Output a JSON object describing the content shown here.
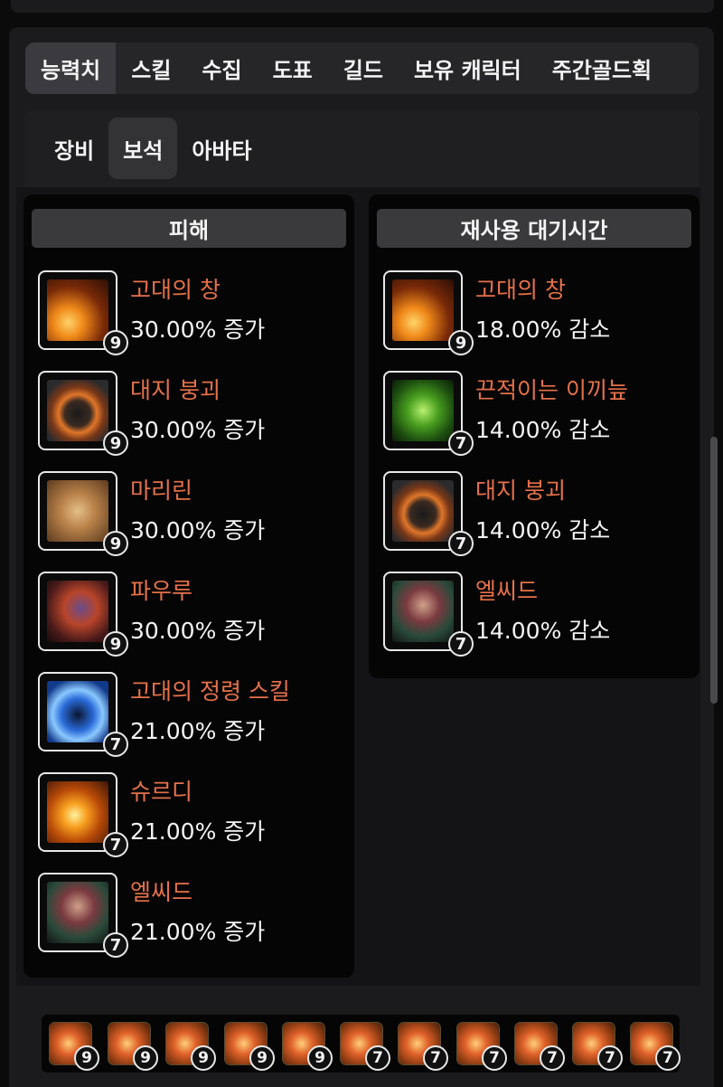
{
  "main_tabs": [
    "능력치",
    "스킬",
    "수집",
    "도표",
    "길드",
    "보유 캐릭터",
    "주간골드획"
  ],
  "sub_tabs": [
    "장비",
    "보석",
    "아바타"
  ],
  "damage": {
    "header": "피해",
    "gems": [
      {
        "name": "고대의 창",
        "value": "30.00% 증가",
        "level": "9",
        "icon": "ancient-spear-icon"
      },
      {
        "name": "대지 붕괴",
        "value": "30.00% 증가",
        "level": "9",
        "icon": "earth-collapse-icon"
      },
      {
        "name": "마리린",
        "value": "30.00% 증가",
        "level": "9",
        "icon": "mariline-icon"
      },
      {
        "name": "파우루",
        "value": "30.00% 증가",
        "level": "9",
        "icon": "pauru-icon"
      },
      {
        "name": "고대의 정령 스킬",
        "value": "21.00% 증가",
        "level": "7",
        "icon": "ancient-spirit-skill-icon"
      },
      {
        "name": "슈르디",
        "value": "21.00% 증가",
        "level": "7",
        "icon": "shurdi-icon"
      },
      {
        "name": "엘씨드",
        "value": "21.00% 증가",
        "level": "7",
        "icon": "elsid-icon"
      }
    ]
  },
  "cooldown": {
    "header": "재사용 대기시간",
    "gems": [
      {
        "name": "고대의 창",
        "value": "18.00% 감소",
        "level": "9",
        "icon": "ancient-spear-icon"
      },
      {
        "name": "끈적이는 이끼늪",
        "value": "14.00% 감소",
        "level": "7",
        "icon": "sticky-moss-swamp-icon"
      },
      {
        "name": "대지 붕괴",
        "value": "14.00% 감소",
        "level": "7",
        "icon": "earth-collapse-icon"
      },
      {
        "name": "엘씨드",
        "value": "14.00% 감소",
        "level": "7",
        "icon": "elsid-icon"
      }
    ]
  },
  "bottom_gems": [
    "9",
    "9",
    "9",
    "9",
    "9",
    "7",
    "7",
    "7",
    "7",
    "7",
    "7"
  ],
  "colors": {
    "gem_name": "#e6714a",
    "active_tab": "#3b3b3f",
    "background": "#0b0b0c"
  }
}
